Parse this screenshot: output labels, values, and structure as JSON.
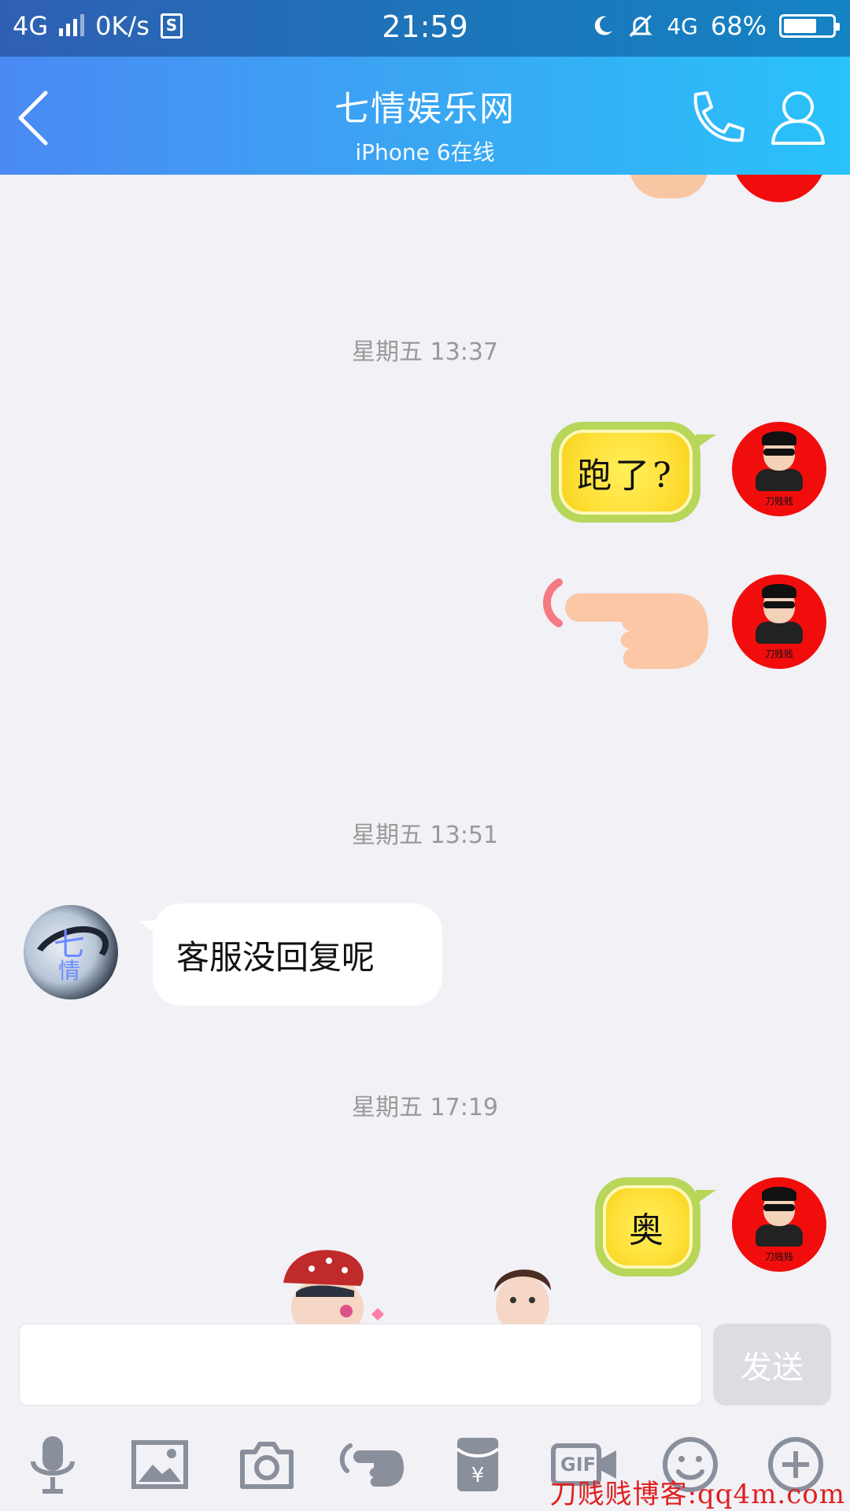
{
  "status_bar": {
    "network": "4G",
    "speed": "0K/s",
    "sim_label": "S",
    "time": "21:59",
    "network_right": "4G",
    "battery": "68%",
    "battery_level": 0.68
  },
  "header": {
    "title": "七情娱乐网",
    "subtitle": "iPhone 6在线"
  },
  "messages": {
    "ts1": "星期五 13:37",
    "m1_text": "跑了?",
    "ts2": "星期五 13:51",
    "m2_text": "客服没回复呢",
    "ts3": "星期五 17:19",
    "m3_text": "奥",
    "avatar_tag": "刀贱贱",
    "left_avatar_glyph": "七",
    "left_avatar_glyph2": "情"
  },
  "input": {
    "value": "",
    "send_label": "发送"
  },
  "toolbar": {
    "gif_label": "GIF",
    "icons": [
      "microphone-icon",
      "image-icon",
      "camera-icon",
      "poke-icon",
      "red-packet-icon",
      "gif-icon",
      "emoji-icon",
      "plus-icon"
    ]
  },
  "watermark": "刀贱贱博客:qq4m.com",
  "colors": {
    "header_start": "#4a8af3",
    "header_end": "#29c2fb",
    "avatar_red": "#f20d0d",
    "lemon_green": "#b7d65a",
    "lemon_yellow": "#ffe03a",
    "toolbar_icon": "#8a8f9c"
  }
}
